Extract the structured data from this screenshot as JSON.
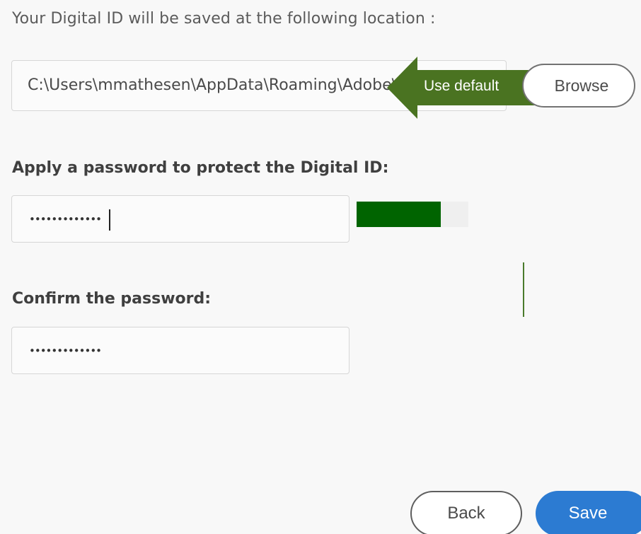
{
  "location": {
    "label": "Your Digital ID will be saved at the following location :",
    "path_value": "C:\\Users\\mmathesen\\AppData\\Roaming\\Adobe\\Acrobat\\DC\\Security\\",
    "use_default_label": "Use default",
    "browse_label": "Browse"
  },
  "password": {
    "label": "Apply a password to protect the Digital ID:",
    "masked_value": "•••••••••••••",
    "strength_fraction": 0.75,
    "strength_color": "#006400"
  },
  "confirm": {
    "label": "Confirm the password:",
    "masked_value": "•••••••••••••"
  },
  "footer": {
    "back_label": "Back",
    "save_label": "Save"
  },
  "colors": {
    "accent": "#2c7bd2",
    "callout": "#4a7321"
  }
}
